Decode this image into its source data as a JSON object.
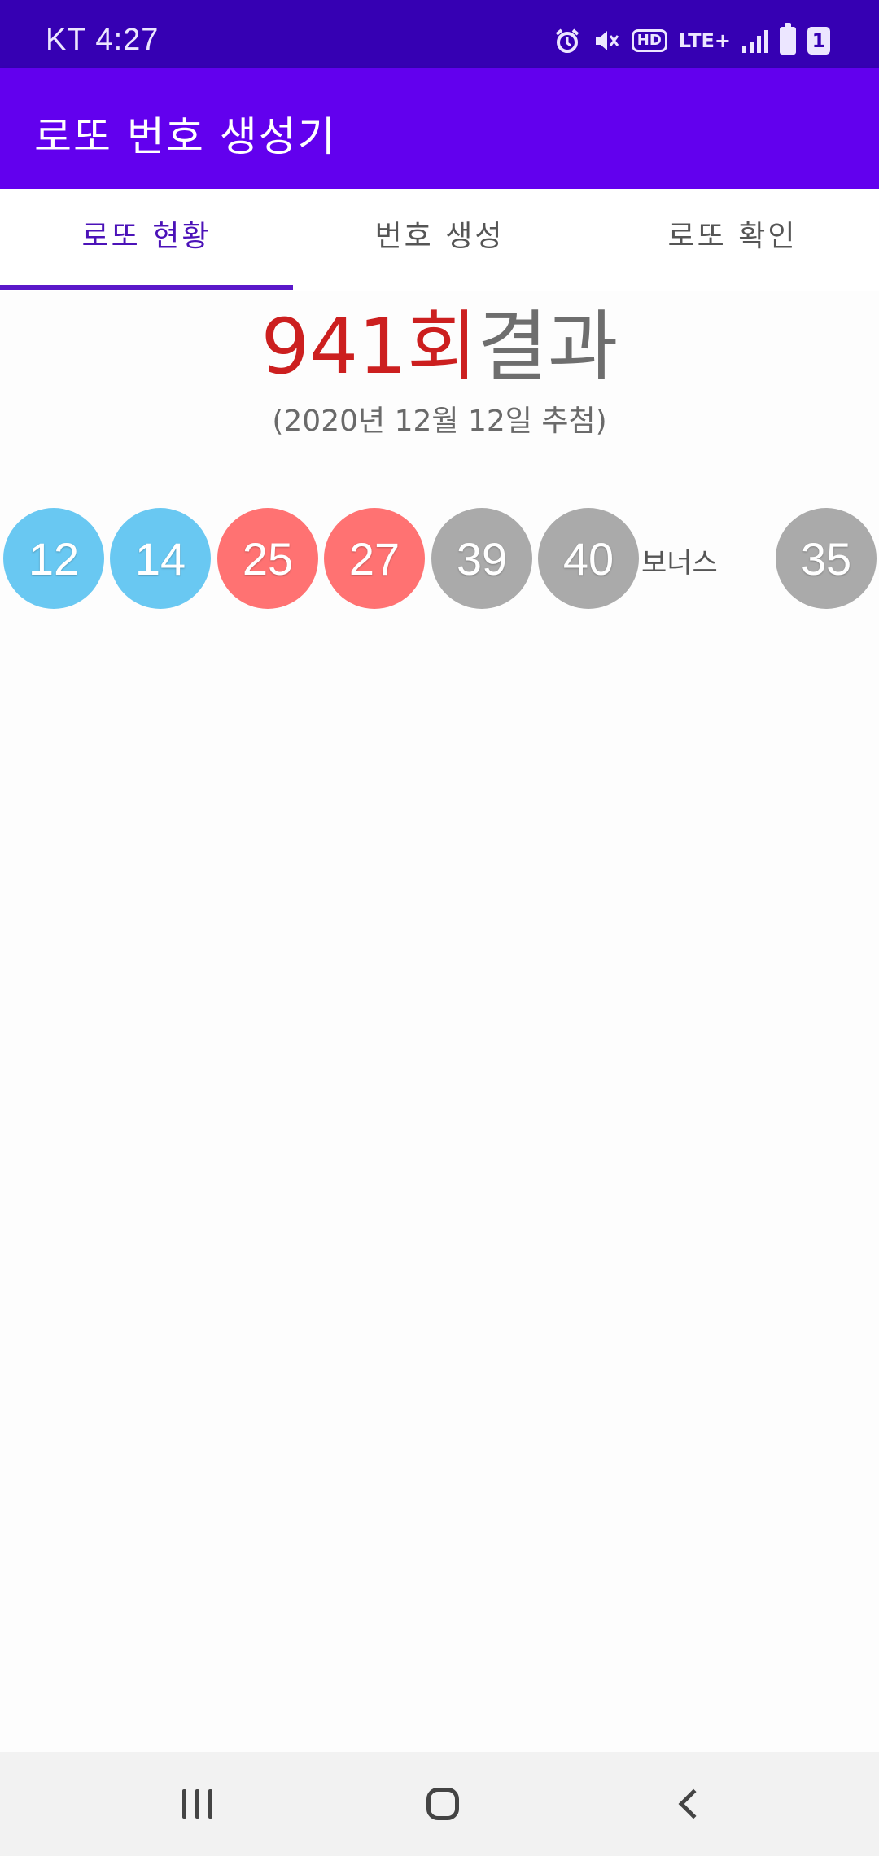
{
  "status_bar": {
    "carrier_time": "KT 4:27",
    "icons": [
      "alarm-icon",
      "mute-icon",
      "hd-icon",
      "lte-plus-icon",
      "signal-icon",
      "battery-icon",
      "sim-1-icon"
    ],
    "hd_text": "HD",
    "lte_text": "LTE+",
    "sim_text": "1"
  },
  "app_bar": {
    "title": "로또 번호 생성기"
  },
  "tabs": [
    {
      "label": "로또 현황",
      "active": true
    },
    {
      "label": "번호 생성",
      "active": false
    },
    {
      "label": "로또 확인",
      "active": false
    }
  ],
  "result": {
    "round": "941회",
    "suffix": "결과",
    "date": "(2020년 12월 12일 추첨)"
  },
  "numbers": [
    {
      "value": "12",
      "color": "#69c8f2"
    },
    {
      "value": "14",
      "color": "#69c8f2"
    },
    {
      "value": "25",
      "color": "#ff7272"
    },
    {
      "value": "27",
      "color": "#ff7272"
    },
    {
      "value": "39",
      "color": "#aaaaaa"
    },
    {
      "value": "40",
      "color": "#aaaaaa"
    }
  ],
  "bonus": {
    "label": "보너스",
    "value": "35",
    "color": "#aaaaaa"
  },
  "colors": {
    "status_bar": "#3600b3",
    "app_bar": "#6200ee",
    "tab_active": "#4b12b8",
    "round_red": "#cc1f1f"
  },
  "nav_bar": {
    "icons": [
      "recent-apps-icon",
      "home-icon",
      "back-icon"
    ]
  }
}
